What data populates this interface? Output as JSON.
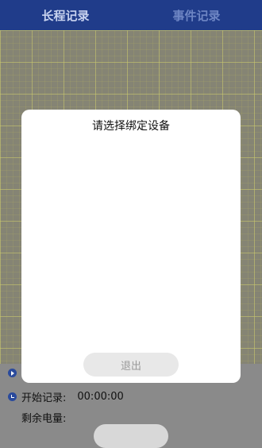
{
  "tabs": [
    {
      "label": "长程记录"
    },
    {
      "label": "事件记录"
    }
  ],
  "status": {
    "start_label": "开始记录:",
    "start_time": "00:00:00",
    "battery_label": "剩余电量:"
  },
  "dialog": {
    "title": "请选择绑定设备",
    "exit_label": "退出"
  },
  "colors": {
    "header": "#203c8a",
    "grid_line": "#c8c66e",
    "dialog_bg": "#ffffff"
  },
  "icons": [
    "play-icon",
    "clock-icon"
  ]
}
